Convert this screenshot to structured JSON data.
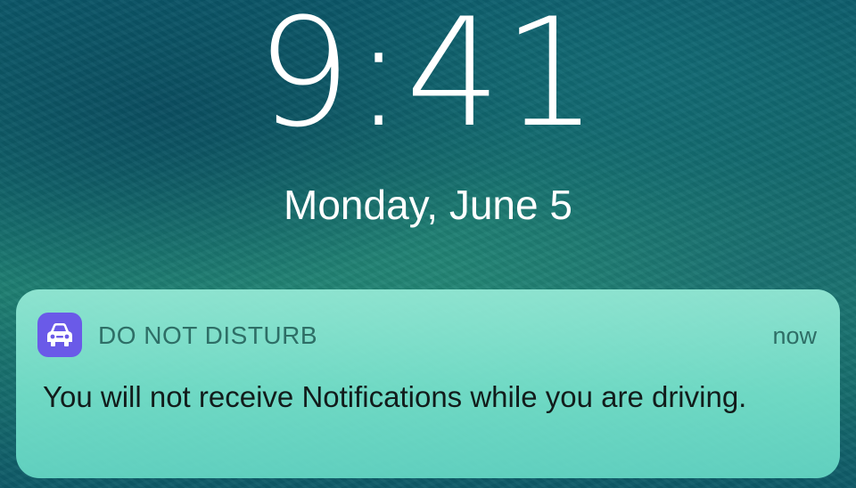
{
  "lock_screen": {
    "time": "9:41",
    "date": "Monday, June 5"
  },
  "notification": {
    "app_icon": "car-icon",
    "app_icon_color": "#6a5ae8",
    "app_name": "DO NOT DISTURB",
    "timestamp": "now",
    "message": "You will not receive Notifications while you are driving."
  }
}
